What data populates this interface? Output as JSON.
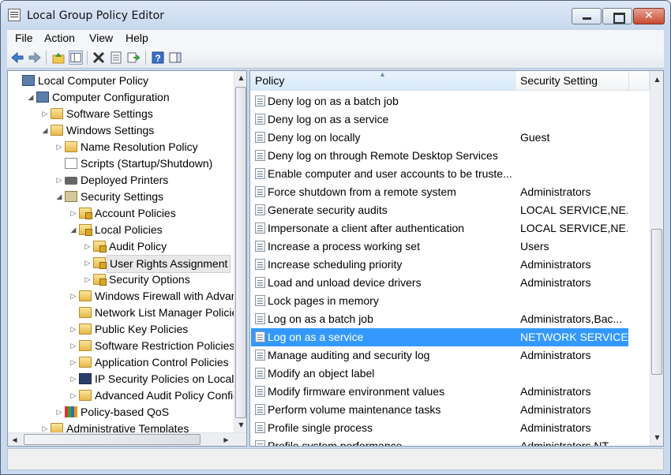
{
  "window": {
    "title": "Local Group Policy Editor"
  },
  "menu": {
    "file": "File",
    "action": "Action",
    "view": "View",
    "help": "Help"
  },
  "toolbar": [
    "back-icon",
    "forward-icon",
    "up-folder-icon",
    "show-hide-tree-icon",
    "delete-icon",
    "properties-icon",
    "export-list-icon",
    "help-icon",
    "show-pane-icon"
  ],
  "tree": [
    {
      "label": "Local Computer Policy",
      "depth": 0,
      "expander": "",
      "icon": "computer-policy-icon"
    },
    {
      "label": "Computer Configuration",
      "depth": 1,
      "expander": "◢",
      "icon": "computer-icon"
    },
    {
      "label": "Software Settings",
      "depth": 2,
      "expander": "▷",
      "icon": "folder-icon"
    },
    {
      "label": "Windows Settings",
      "depth": 2,
      "expander": "◢",
      "icon": "folder-icon"
    },
    {
      "label": "Name Resolution Policy",
      "depth": 3,
      "expander": "▷",
      "icon": "folder-icon"
    },
    {
      "label": "Scripts (Startup/Shutdown)",
      "depth": 3,
      "expander": "",
      "icon": "script-icon"
    },
    {
      "label": "Deployed Printers",
      "depth": 3,
      "expander": "▷",
      "icon": "printer-icon"
    },
    {
      "label": "Security Settings",
      "depth": 3,
      "expander": "◢",
      "icon": "security-settings-icon"
    },
    {
      "label": "Account Policies",
      "depth": 4,
      "expander": "▷",
      "icon": "secure-folder-icon"
    },
    {
      "label": "Local Policies",
      "depth": 4,
      "expander": "◢",
      "icon": "secure-folder-icon"
    },
    {
      "label": "Audit Policy",
      "depth": 5,
      "expander": "▷",
      "icon": "secure-folder-icon"
    },
    {
      "label": "User Rights Assignment",
      "depth": 5,
      "expander": "▷",
      "icon": "secure-folder-icon",
      "selected": true
    },
    {
      "label": "Security Options",
      "depth": 5,
      "expander": "▷",
      "icon": "secure-folder-icon"
    },
    {
      "label": "Windows Firewall with Advan",
      "depth": 4,
      "expander": "▷",
      "icon": "folder-icon"
    },
    {
      "label": "Network List Manager Policie",
      "depth": 4,
      "expander": "",
      "icon": "folder-icon"
    },
    {
      "label": "Public Key Policies",
      "depth": 4,
      "expander": "▷",
      "icon": "folder-icon"
    },
    {
      "label": "Software Restriction Policies",
      "depth": 4,
      "expander": "▷",
      "icon": "folder-icon"
    },
    {
      "label": "Application Control Policies",
      "depth": 4,
      "expander": "▷",
      "icon": "folder-icon"
    },
    {
      "label": "IP Security Policies on Local C",
      "depth": 4,
      "expander": "▷",
      "icon": "ip-security-icon"
    },
    {
      "label": "Advanced Audit Policy Configu",
      "depth": 4,
      "expander": "▷",
      "icon": "folder-icon"
    },
    {
      "label": "Policy-based QoS",
      "depth": 3,
      "expander": "▷",
      "icon": "qos-chart-icon"
    },
    {
      "label": "Administrative Templates",
      "depth": 2,
      "expander": "▷",
      "icon": "folder-icon"
    }
  ],
  "list": {
    "columns": {
      "policy": "Policy",
      "setting": "Security Setting"
    },
    "rows": [
      {
        "policy": "Deny log on as a batch job",
        "setting": ""
      },
      {
        "policy": "Deny log on as a service",
        "setting": ""
      },
      {
        "policy": "Deny log on locally",
        "setting": "Guest"
      },
      {
        "policy": "Deny log on through Remote Desktop Services",
        "setting": ""
      },
      {
        "policy": "Enable computer and user accounts to be truste...",
        "setting": ""
      },
      {
        "policy": "Force shutdown from a remote system",
        "setting": "Administrators"
      },
      {
        "policy": "Generate security audits",
        "setting": "LOCAL SERVICE,NE..."
      },
      {
        "policy": "Impersonate a client after authentication",
        "setting": "LOCAL SERVICE,NE..."
      },
      {
        "policy": "Increase a process working set",
        "setting": "Users"
      },
      {
        "policy": "Increase scheduling priority",
        "setting": "Administrators"
      },
      {
        "policy": "Load and unload device drivers",
        "setting": "Administrators"
      },
      {
        "policy": "Lock pages in memory",
        "setting": ""
      },
      {
        "policy": "Log on as a batch job",
        "setting": "Administrators,Bac..."
      },
      {
        "policy": "Log on as a service",
        "setting": "NETWORK SERVICE...",
        "selected": true
      },
      {
        "policy": "Manage auditing and security log",
        "setting": "Administrators"
      },
      {
        "policy": "Modify an object label",
        "setting": ""
      },
      {
        "policy": "Modify firmware environment values",
        "setting": "Administrators"
      },
      {
        "policy": "Perform volume maintenance tasks",
        "setting": "Administrators"
      },
      {
        "policy": "Profile single process",
        "setting": "Administrators"
      },
      {
        "policy": "Profile system performance",
        "setting": "Administrators,NT..."
      }
    ]
  },
  "colors": {
    "selection": "#3399ff",
    "titlebar": "#c9d9ee"
  }
}
